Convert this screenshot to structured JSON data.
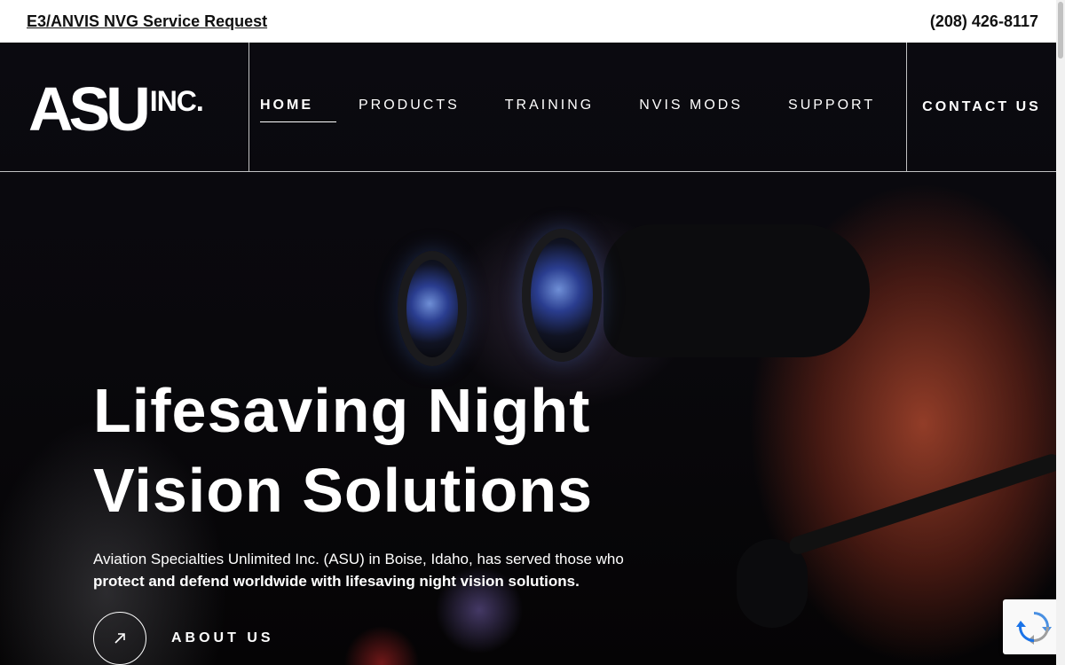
{
  "topbar": {
    "service_link": "E3/ANVIS NVG Service Request",
    "phone": "(208) 426-8117"
  },
  "header": {
    "logo_main": "ASU",
    "logo_suffix": "INC.",
    "nav": [
      {
        "label": "HOME",
        "active": true
      },
      {
        "label": "PRODUCTS"
      },
      {
        "label": "TRAINING"
      },
      {
        "label": "NVIS MODS"
      },
      {
        "label": "SUPPORT"
      }
    ],
    "contact_label": "CONTACT US"
  },
  "hero": {
    "headline_line1": "Lifesaving Night",
    "headline_line2": "Vision Solutions",
    "subtext_regular": "Aviation Specialties Unlimited Inc. (ASU) in Boise, Idaho, has served those who",
    "subtext_bold": "protect and defend worldwide with lifesaving night vision solutions.",
    "cta_icon": "arrow-up-right-icon",
    "cta_label": "ABOUT US"
  },
  "recaptcha": {
    "icon": "recaptcha-icon"
  }
}
